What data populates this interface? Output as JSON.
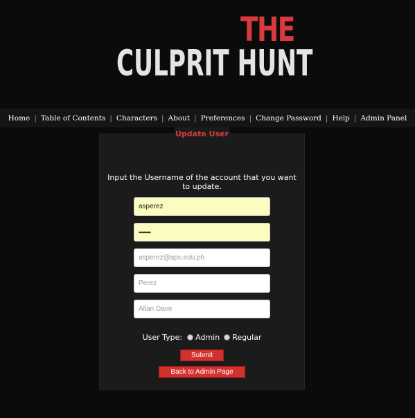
{
  "logo": {
    "line1": "THE",
    "line2": "CULPRIT HUNT"
  },
  "nav": {
    "items": [
      {
        "label": "Home"
      },
      {
        "label": "Table of Contents"
      },
      {
        "label": "Characters"
      },
      {
        "label": "About"
      },
      {
        "label": "Preferences"
      },
      {
        "label": "Change Password"
      },
      {
        "label": "Help"
      },
      {
        "label": "Admin Panel"
      }
    ],
    "separator": "|"
  },
  "panel": {
    "title": "Update User",
    "instructions": "Input the Username of the account that you want to update."
  },
  "form": {
    "username": {
      "value": "asperez"
    },
    "password": {
      "value": "••••••••"
    },
    "email": {
      "placeholder": "asperez@apc.edu.ph"
    },
    "last_name": {
      "placeholder": "Perez"
    },
    "first_name": {
      "placeholder": "Allan Dave"
    },
    "user_type": {
      "label": "User Type:",
      "options": [
        "Admin",
        "Regular"
      ]
    },
    "submit_label": "Submit",
    "back_label": "Back to Admin Page"
  },
  "colors": {
    "accent": "#d83a3e",
    "nav_separator": "#6ec04a",
    "autofill": "#fbfcbf",
    "background": "#0b0b0b"
  }
}
